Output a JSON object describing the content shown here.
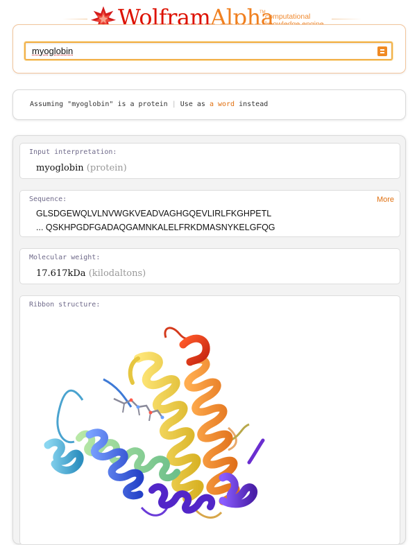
{
  "header": {
    "logo_prefix": "Wolfram",
    "logo_suffix": "Alpha",
    "tagline_line1": "computational",
    "tagline_line2": "knowledge engine",
    "tm": "TM"
  },
  "search": {
    "query": "myoglobin",
    "submit_icon": "equals-icon"
  },
  "assumption": {
    "prefix": "Assuming \"myoglobin\" is a protein",
    "separator": "|",
    "use_as": "Use as",
    "link_text": "a word",
    "suffix": "instead"
  },
  "pods": {
    "input_interpretation": {
      "title": "Input interpretation:",
      "value": "myoglobin",
      "qualifier": "(protein)"
    },
    "sequence": {
      "title": "Sequence:",
      "more_label": "More",
      "line1": "GLSDGEWQLVLNVWGKVEADVAGHGQEVLIRLFKGHPETL",
      "line2_prefix": "...",
      "line2": "QSKHPGDFGADAQGAMNKALELFRKDMASNYKELGFQG"
    },
    "molecular_weight": {
      "title": "Molecular weight:",
      "value": "17.617",
      "unit": "kDa",
      "unit_name": "(kilodaltons)"
    },
    "ribbon_structure": {
      "title": "Ribbon structure:"
    }
  },
  "colors": {
    "brand_red": "#dd1100",
    "brand_orange": "#f08a24",
    "link_orange": "#e07010",
    "pod_title": "#6f6a8a"
  }
}
